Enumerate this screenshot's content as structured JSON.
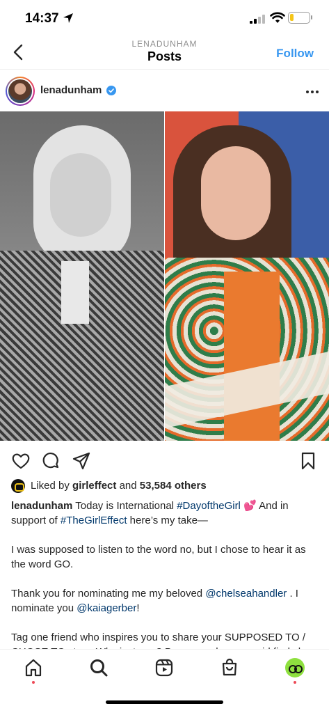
{
  "status_bar": {
    "time": "14:37",
    "battery_level": 0.2,
    "battery_color": "#f5c518"
  },
  "nav": {
    "subtitle": "LENADUNHAM",
    "title": "Posts",
    "follow_label": "Follow",
    "follow_color": "#3897f0"
  },
  "post": {
    "username": "lenadunham",
    "verified_icon": "verified-badge-icon",
    "likes": {
      "prefix": "Liked by ",
      "liker": "girleffect",
      "middle": " and ",
      "count": "53,584 others"
    },
    "caption": {
      "username": "lenadunham",
      "p1_a": " Today is International ",
      "p1_tag1": "#DayoftheGirl",
      "p1_emoji": "💕",
      "p1_b": " And in support of ",
      "p1_tag2": "#TheGirlEffect",
      "p1_c": " here’s my take—",
      "p2": "I was supposed to listen to the word no, but I chose to hear it as the word GO.",
      "p3_a": "Thank you for nominating me my beloved ",
      "p3_mention1": "@chelseahandler",
      "p3_b": " . I nominate you ",
      "p3_mention2": "@kaiagerber",
      "p3_c": "!",
      "p4": "Tag one friend who inspires you to share your SUPPOSED TO / CHOSE TO story. Why just one? Because when one girl finds her power to make different choices that change her"
    }
  },
  "tabbar": {
    "items": [
      "home-icon",
      "search-icon",
      "reels-icon",
      "shop-icon",
      "profile-avatar"
    ]
  }
}
